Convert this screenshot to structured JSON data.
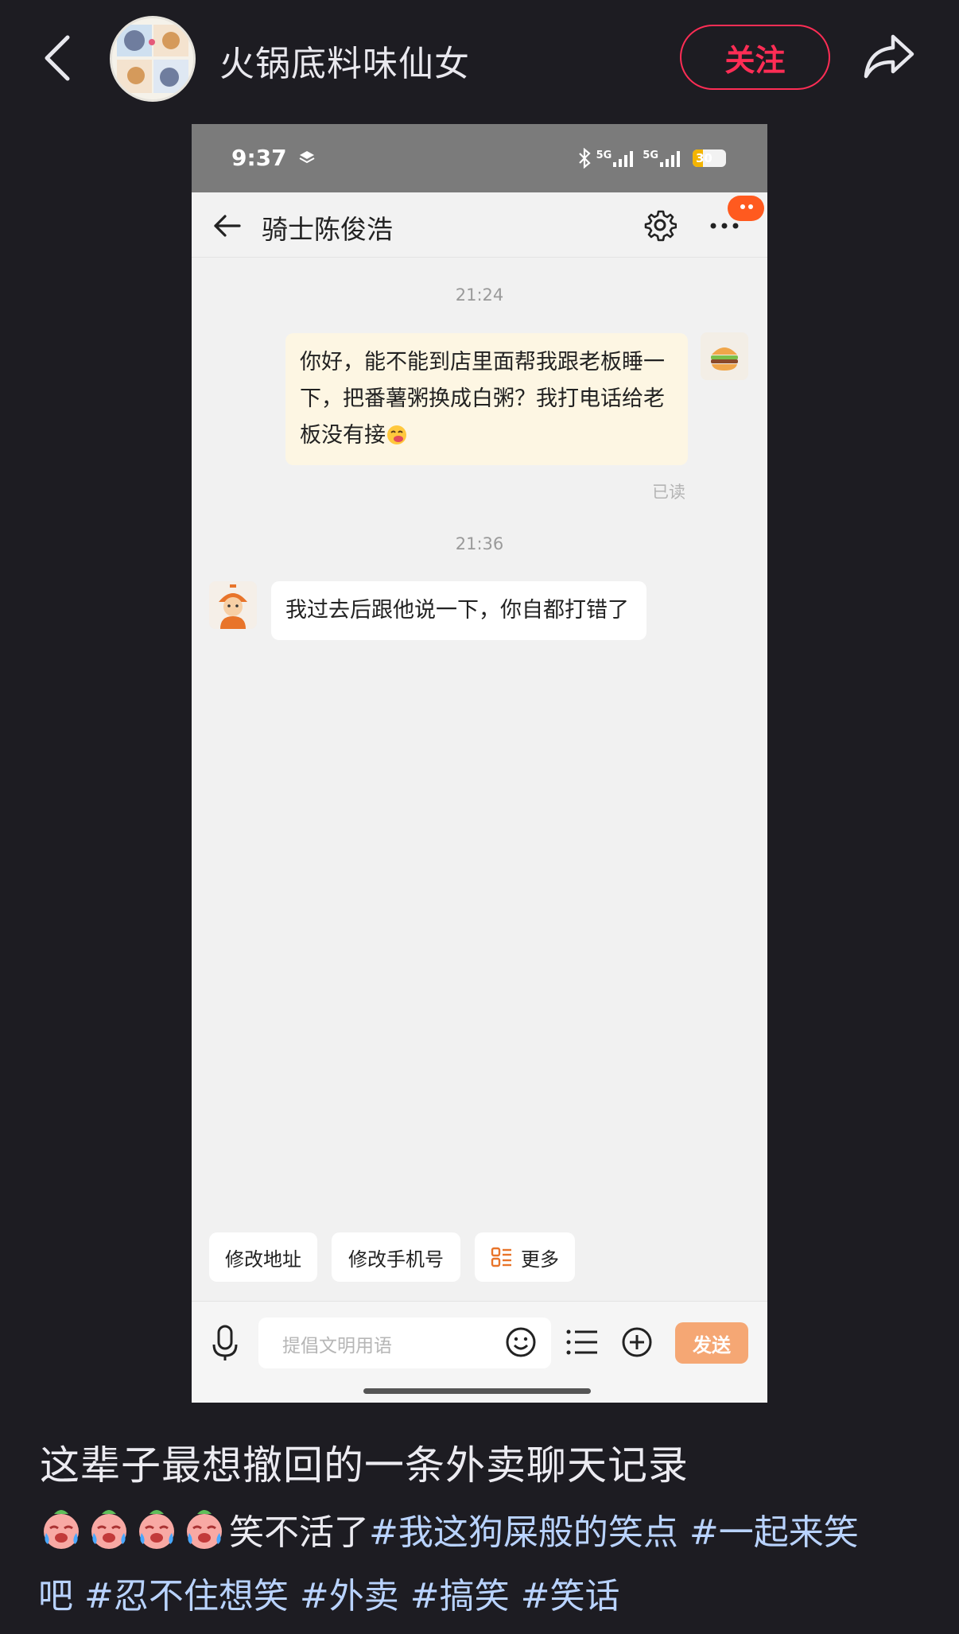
{
  "header": {
    "author_name": "火锅底料味仙女",
    "follow_label": "关注",
    "icons": {
      "back": "back-arrow-icon",
      "share": "share-arrow-icon"
    }
  },
  "screenshot": {
    "status_bar": {
      "time": "9:37",
      "network_1": "5G",
      "network_2": "5G",
      "battery": "30",
      "battery_level": 0.3
    },
    "nav": {
      "title": "骑士陈俊浩",
      "icons": {
        "back": "back-arrow-icon",
        "settings": "gear-icon",
        "more": "more-dots-icon"
      }
    },
    "messages": [
      {
        "timestamp": "21:24",
        "sender": "me",
        "text": "你好，能不能到店里面帮我跟老板睡一下，把番薯粥换成白粥？我打电话给老板没有接",
        "status": "已读"
      },
      {
        "timestamp": "21:36",
        "sender": "rider",
        "text": "我过去后跟他说一下，你自都打错了"
      }
    ],
    "quick_actions": [
      "修改地址",
      "修改手机号",
      "更多"
    ],
    "input": {
      "placeholder": "提倡文明用语",
      "send_label": "发送"
    }
  },
  "post": {
    "title": "这辈子最想撤回的一条外卖聊天记录",
    "desc_text": "笑不活了",
    "desc_emoji_count": 4,
    "hashtags_line1": [
      "#我这狗屎般的笑点",
      "#一起来笑"
    ],
    "hashtags_line2_prefix": "吧",
    "hashtags_line2": [
      "#忍不住想笑",
      "#外卖",
      "#搞笑",
      "#笑话"
    ]
  },
  "colors": {
    "background": "#1d1c22",
    "follow_accent": "#ff2d55",
    "hashtag": "#b9d3ff",
    "send_button": "#f5a774"
  }
}
